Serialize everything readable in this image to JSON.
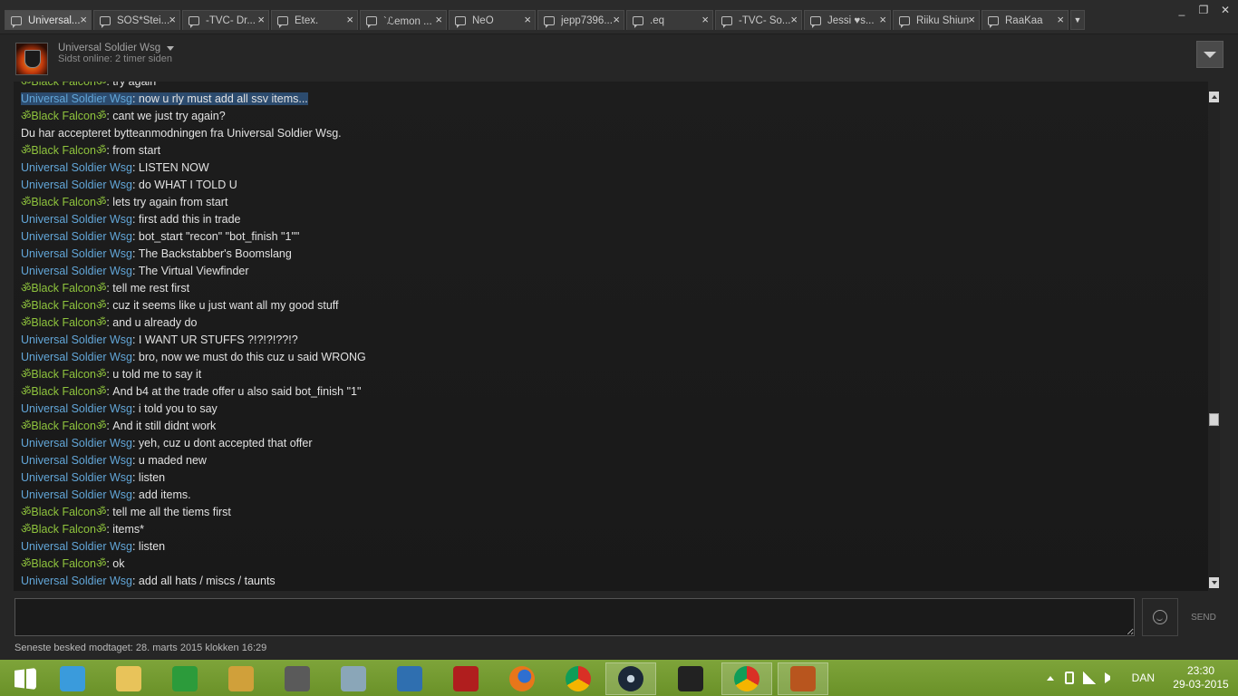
{
  "tabs": [
    {
      "label": "Universal...",
      "active": true
    },
    {
      "label": "SOS*Stei...",
      "active": false
    },
    {
      "label": "-TVC- Dr...",
      "active": false
    },
    {
      "label": "Etex.",
      "active": false
    },
    {
      "label": "`ℒemon ...",
      "active": false
    },
    {
      "label": "NeO",
      "active": false
    },
    {
      "label": "jepp7396...",
      "active": false
    },
    {
      "label": ".eq",
      "active": false
    },
    {
      "label": "-TVC- So...",
      "active": false
    },
    {
      "label": "Jessi ♥s...",
      "active": false
    },
    {
      "label": "Riiku Shiun",
      "active": false
    },
    {
      "label": "RaaKaa",
      "active": false
    }
  ],
  "window": {
    "minimize": "_",
    "restore": "❐",
    "close": "✕"
  },
  "header": {
    "friend_name": "Universal Soldier Wsg",
    "status": "Sidst online: 2 timer siden"
  },
  "messages": [
    {
      "kind": "them",
      "sender": "ॐBlack Falconॐ",
      "text": ": try again"
    },
    {
      "kind": "me",
      "sender": "Universal Soldier Wsg",
      "text": ": now u rly must add all ssv items...",
      "highlight": true
    },
    {
      "kind": "them",
      "sender": "ॐBlack Falconॐ",
      "text": ": cant we just try again?"
    },
    {
      "kind": "system",
      "sender": "",
      "text": "Du har accepteret bytteanmodningen fra Universal Soldier Wsg."
    },
    {
      "kind": "them",
      "sender": "ॐBlack Falconॐ",
      "text": ": from start"
    },
    {
      "kind": "me",
      "sender": "Universal Soldier Wsg",
      "text": ": LISTEN NOW"
    },
    {
      "kind": "me",
      "sender": "Universal Soldier Wsg",
      "text": ": do WHAT I TOLD U"
    },
    {
      "kind": "them",
      "sender": "ॐBlack Falconॐ",
      "text": ": lets try again from start"
    },
    {
      "kind": "me",
      "sender": "Universal Soldier Wsg",
      "text": ": first add this in trade"
    },
    {
      "kind": "me",
      "sender": "Universal Soldier Wsg",
      "text": ": bot_start \"recon\" \"bot_finish \"1\"\""
    },
    {
      "kind": "me",
      "sender": "Universal Soldier Wsg",
      "text": ": The Backstabber's Boomslang"
    },
    {
      "kind": "me",
      "sender": "Universal Soldier Wsg",
      "text": ": The Virtual Viewfinder"
    },
    {
      "kind": "them",
      "sender": "ॐBlack Falconॐ",
      "text": ": tell me rest first"
    },
    {
      "kind": "them",
      "sender": "ॐBlack Falconॐ",
      "text": ": cuz it seems like u just want all my good stuff"
    },
    {
      "kind": "them",
      "sender": "ॐBlack Falconॐ",
      "text": ": and u already do"
    },
    {
      "kind": "me",
      "sender": "Universal Soldier Wsg",
      "text": ": I WANT UR STUFFS ?!?!?!??!?"
    },
    {
      "kind": "me",
      "sender": "Universal Soldier Wsg",
      "text": ": bro, now we must do this cuz u said WRONG"
    },
    {
      "kind": "them",
      "sender": "ॐBlack Falconॐ",
      "text": ": u told me to say it"
    },
    {
      "kind": "them",
      "sender": "ॐBlack Falconॐ",
      "text": ": And b4 at the trade offer u also said bot_finish \"1\""
    },
    {
      "kind": "me",
      "sender": "Universal Soldier Wsg",
      "text": ": i told you to say"
    },
    {
      "kind": "them",
      "sender": "ॐBlack Falconॐ",
      "text": ": And it still didnt work"
    },
    {
      "kind": "me",
      "sender": "Universal Soldier Wsg",
      "text": ": yeh, cuz u dont accepted that offer"
    },
    {
      "kind": "me",
      "sender": "Universal Soldier Wsg",
      "text": ": u maded new"
    },
    {
      "kind": "me",
      "sender": "Universal Soldier Wsg",
      "text": ": listen"
    },
    {
      "kind": "me",
      "sender": "Universal Soldier Wsg",
      "text": ": add items."
    },
    {
      "kind": "them",
      "sender": "ॐBlack Falconॐ",
      "text": ": tell me all the tiems first"
    },
    {
      "kind": "them",
      "sender": "ॐBlack Falconॐ",
      "text": ": items*"
    },
    {
      "kind": "me",
      "sender": "Universal Soldier Wsg",
      "text": ": listen"
    },
    {
      "kind": "them",
      "sender": "ॐBlack Falconॐ",
      "text": ": ok"
    },
    {
      "kind": "me",
      "sender": "Universal Soldier Wsg",
      "text": ": add all hats / miscs / taunts"
    }
  ],
  "input": {
    "value": "",
    "send_label": "SEND"
  },
  "footer": {
    "last_message": "Seneste besked modtaget: 28. marts 2015 klokken 16:29"
  },
  "colors": {
    "me": "#62a6d8",
    "them": "#8fc43d",
    "highlight": "#2c4b6e",
    "taskbar": "#7ea43a"
  },
  "taskbar": {
    "apps": [
      {
        "name": "start-button",
        "icon": "windows-logo-icon",
        "active": false
      },
      {
        "name": "internet-explorer",
        "icon": "internet-explorer-icon",
        "active": false
      },
      {
        "name": "file-explorer",
        "icon": "folder-icon",
        "active": false
      },
      {
        "name": "windows-store",
        "icon": "store-icon",
        "active": false
      },
      {
        "name": "app-gold",
        "icon": "gold-app-icon",
        "active": false
      },
      {
        "name": "speaker-app",
        "icon": "speaker-icon",
        "active": false
      },
      {
        "name": "doc-app",
        "icon": "document-icon",
        "active": false
      },
      {
        "name": "settings-app",
        "icon": "settings-panel-icon",
        "active": false
      },
      {
        "name": "power-app",
        "icon": "power-icon",
        "active": false
      },
      {
        "name": "firefox",
        "icon": "firefox-icon",
        "active": false
      },
      {
        "name": "chrome",
        "icon": "chrome-icon",
        "active": false
      },
      {
        "name": "steam",
        "icon": "steam-icon",
        "active": true
      },
      {
        "name": "command-prompt",
        "icon": "terminal-icon",
        "active": false
      },
      {
        "name": "chrome-2",
        "icon": "chrome-icon",
        "active": true
      },
      {
        "name": "team-fortress-2",
        "icon": "tf2-icon",
        "active": true
      }
    ],
    "language": "DAN",
    "time": "23:30",
    "date": "29-03-2015"
  }
}
